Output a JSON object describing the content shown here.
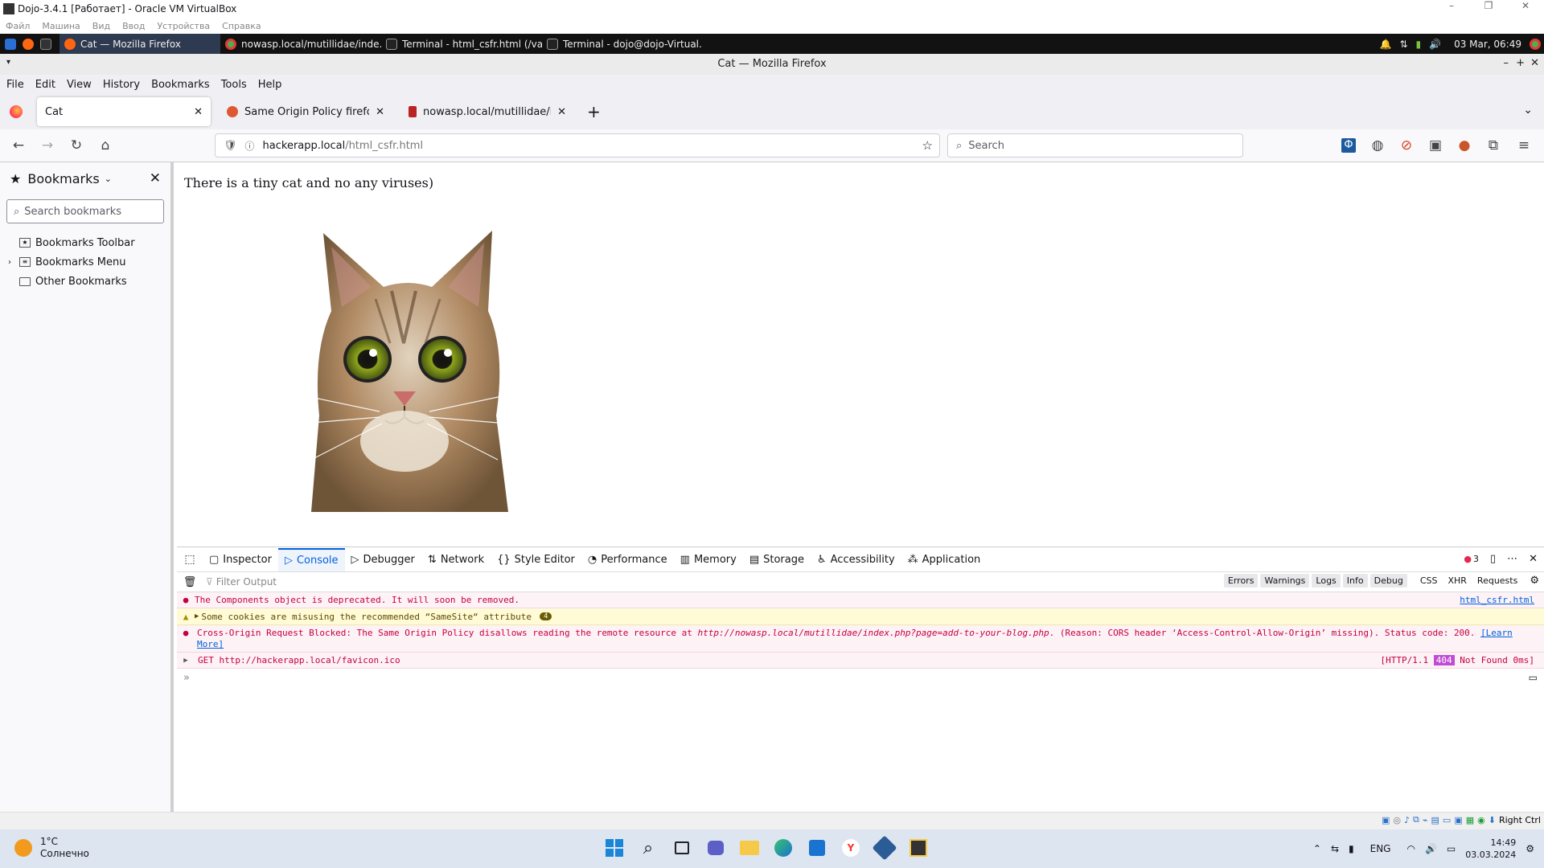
{
  "vbox": {
    "title": "Dojo-3.4.1 [Работает] - Oracle VM VirtualBox",
    "menu": [
      "Файл",
      "Машина",
      "Вид",
      "Ввод",
      "Устройства",
      "Справка"
    ],
    "host_key": "Right Ctrl"
  },
  "guest_taskbar": {
    "apps": [
      {
        "label": "Cat — Mozilla Firefox",
        "active": true
      },
      {
        "label": "nowasp.local/mutillidae/inde...",
        "active": false
      },
      {
        "label": "Terminal - html_csfr.html (/va...",
        "active": false
      },
      {
        "label": "Terminal - dojo@dojo-Virtual...",
        "active": false
      }
    ],
    "clock": "03 Mar, 06:49"
  },
  "firefox": {
    "window_title": "Cat — Mozilla Firefox",
    "menubar": [
      "File",
      "Edit",
      "View",
      "History",
      "Bookmarks",
      "Tools",
      "Help"
    ],
    "tabs": [
      {
        "label": "Cat",
        "active": true
      },
      {
        "label": "Same Origin Policy firefox at t",
        "active": false
      },
      {
        "label": "nowasp.local/mutillidae/inde",
        "active": false
      }
    ],
    "url_host": "hackerapp.local",
    "url_path": "/html_csfr.html",
    "search_placeholder": "Search"
  },
  "sidebar": {
    "title": "Bookmarks",
    "search_placeholder": "Search bookmarks",
    "items": [
      "Bookmarks Toolbar",
      "Bookmarks Menu",
      "Other Bookmarks"
    ]
  },
  "page": {
    "heading": "There is a tiny cat and no any viruses)"
  },
  "devtools": {
    "tabs": [
      "Inspector",
      "Console",
      "Debugger",
      "Network",
      "Style Editor",
      "Performance",
      "Memory",
      "Storage",
      "Accessibility",
      "Application"
    ],
    "error_count": "3",
    "filter_placeholder": "Filter Output",
    "filters": [
      "Errors",
      "Warnings",
      "Logs",
      "Info",
      "Debug",
      "CSS",
      "XHR",
      "Requests"
    ],
    "logs": {
      "components_msg": "The Components object is deprecated. It will soon be removed.",
      "components_src": "html_csfr.html",
      "cookie_msg": "Some cookies are misusing the recommended “SameSite“ attribute",
      "cookie_count": "4",
      "cors_msg_1": "Cross-Origin Request Blocked: The Same Origin Policy disallows reading the remote resource at ",
      "cors_url": "http://nowasp.local/mutillidae/index.php?page=add-to-your-blog.php",
      "cors_msg_2": ". (Reason: CORS header ‘Access-Control-Allow-Origin’ missing). Status code: 200. ",
      "cors_learn": "[Learn More]",
      "get_msg": "GET http://hackerapp.local/favicon.ico",
      "get_status_1": "[HTTP/1.1 ",
      "get_status_code": "404",
      "get_status_2": " Not Found 0ms]"
    }
  },
  "host_taskbar": {
    "weather_temp": "1°C",
    "weather_desc": "Солнечно",
    "lang": "ENG",
    "time": "14:49",
    "date": "03.03.2024"
  },
  "colors": {
    "accent": "#0060df",
    "error_bg": "#fdf2f5",
    "error_text": "#c50042",
    "warning_bg": "#fffbd6"
  }
}
